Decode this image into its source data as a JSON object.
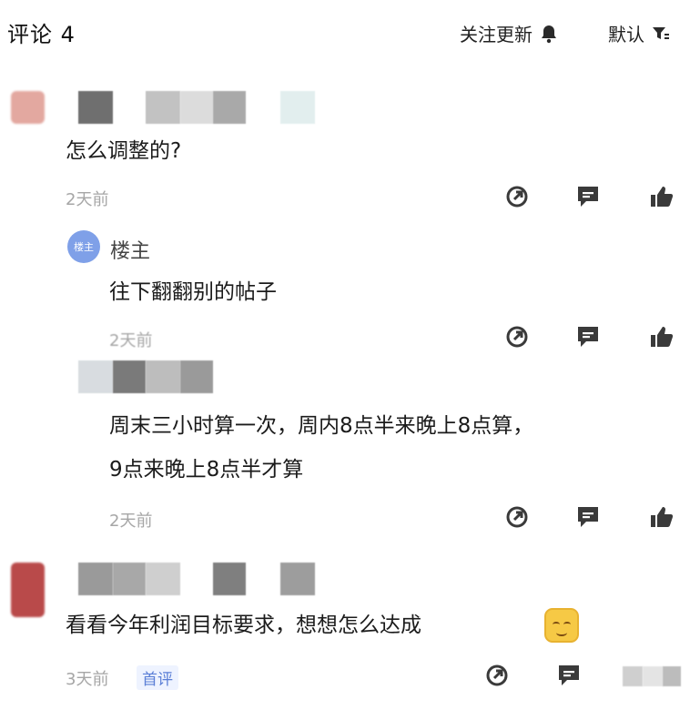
{
  "header": {
    "title": "评论 4",
    "follow_label": "关注更新",
    "sort_label": "默认"
  },
  "comments": [
    {
      "text": "怎么调整的?",
      "time": "2天前",
      "replies": [
        {
          "author": "楼主",
          "badge": "楼主",
          "text": "往下翻翻别的帖子",
          "time": "2天前"
        },
        {
          "text_line1": "周末三小时算一次，周内8点半来晚上8点算，",
          "text_line2": "9点来晚上8点半才算",
          "time": "2天前"
        }
      ]
    },
    {
      "text": "看看今年利润目标要求，想想怎么达成",
      "time": "3天前",
      "tag": "首评"
    }
  ],
  "icons": {
    "follow": "bell-icon",
    "sort": "filter-icon",
    "share": "share-icon",
    "reply": "reply-icon",
    "like": "thumbs-up-icon",
    "emoji": "smile-emoji-icon"
  },
  "colors": {
    "accent": "#5b7fd6",
    "icon": "#3a3a3a",
    "muted": "#a6a6a6"
  }
}
